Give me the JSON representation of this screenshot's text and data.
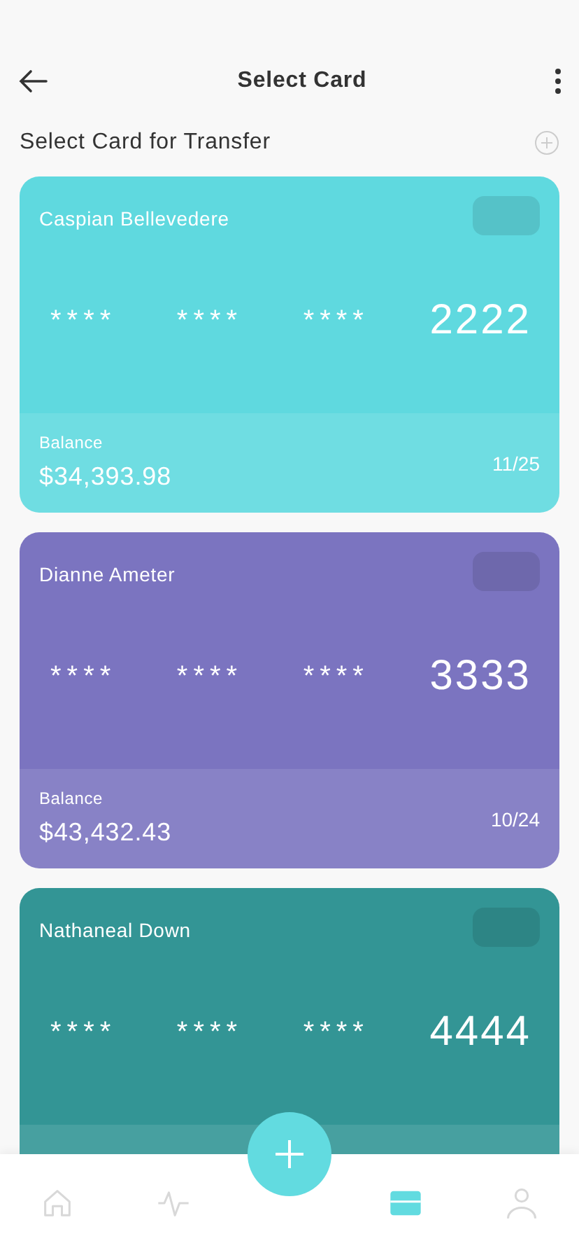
{
  "header": {
    "title": "Select Card"
  },
  "section": {
    "title": "Select Card for Transfer"
  },
  "cards": [
    {
      "holder": "Caspian Bellevedere",
      "groups": [
        "****",
        "****",
        "****"
      ],
      "last4": "2222",
      "balance_label": "Balance",
      "balance": "$34,393.98",
      "expiry": "11/25",
      "color": "#5fd9df"
    },
    {
      "holder": "Dianne Ameter",
      "groups": [
        "****",
        "****",
        "****"
      ],
      "last4": "3333",
      "balance_label": "Balance",
      "balance": "$43,432.43",
      "expiry": "10/24",
      "color": "#7b74c0"
    },
    {
      "holder": "Nathaneal Down",
      "groups": [
        "****",
        "****",
        "****"
      ],
      "last4": "4444",
      "color": "#339595"
    }
  ],
  "nav": [
    {
      "kind": "home",
      "selected": false
    },
    {
      "kind": "activity",
      "selected": false
    },
    {
      "kind": "cards",
      "selected": true
    },
    {
      "kind": "profile",
      "selected": false
    }
  ]
}
